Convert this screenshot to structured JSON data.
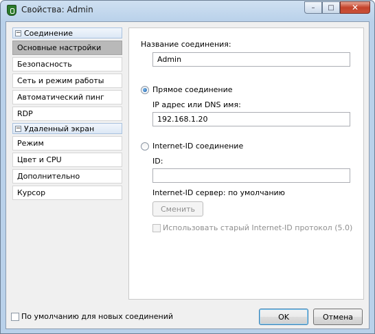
{
  "window": {
    "title": "Свойства: Admin",
    "caption": {
      "minimize": "–",
      "maximize": "□",
      "close": "✕"
    }
  },
  "sidebar": {
    "groups": [
      {
        "label": "Соединение",
        "toggle": "−",
        "items": [
          "Основные настройки",
          "Безопасность",
          "Сеть и режим работы",
          "Автоматический пинг",
          "RDP"
        ]
      },
      {
        "label": "Удаленный экран",
        "toggle": "−",
        "items": [
          "Режим",
          "Цвет и CPU",
          "Дополнительно",
          "Курсор"
        ]
      }
    ],
    "active_item": "Основные настройки"
  },
  "panel": {
    "connection_name_label": "Название соединения:",
    "connection_name_value": "Admin",
    "direct_radio_label": "Прямое соединение",
    "ip_label": "IP адрес или DNS имя:",
    "ip_value": "192.168.1.20",
    "internet_id_radio_label": "Internet-ID соединение",
    "id_label": "ID:",
    "id_value": "",
    "server_label": "Internet-ID сервер: по умолчанию",
    "change_button": "Сменить",
    "old_protocol_label": "Использовать старый Internet-ID протокол (5.0)"
  },
  "footer": {
    "default_checkbox_label": "По умолчанию для новых соединений",
    "ok": "OK",
    "cancel": "Отмена"
  }
}
